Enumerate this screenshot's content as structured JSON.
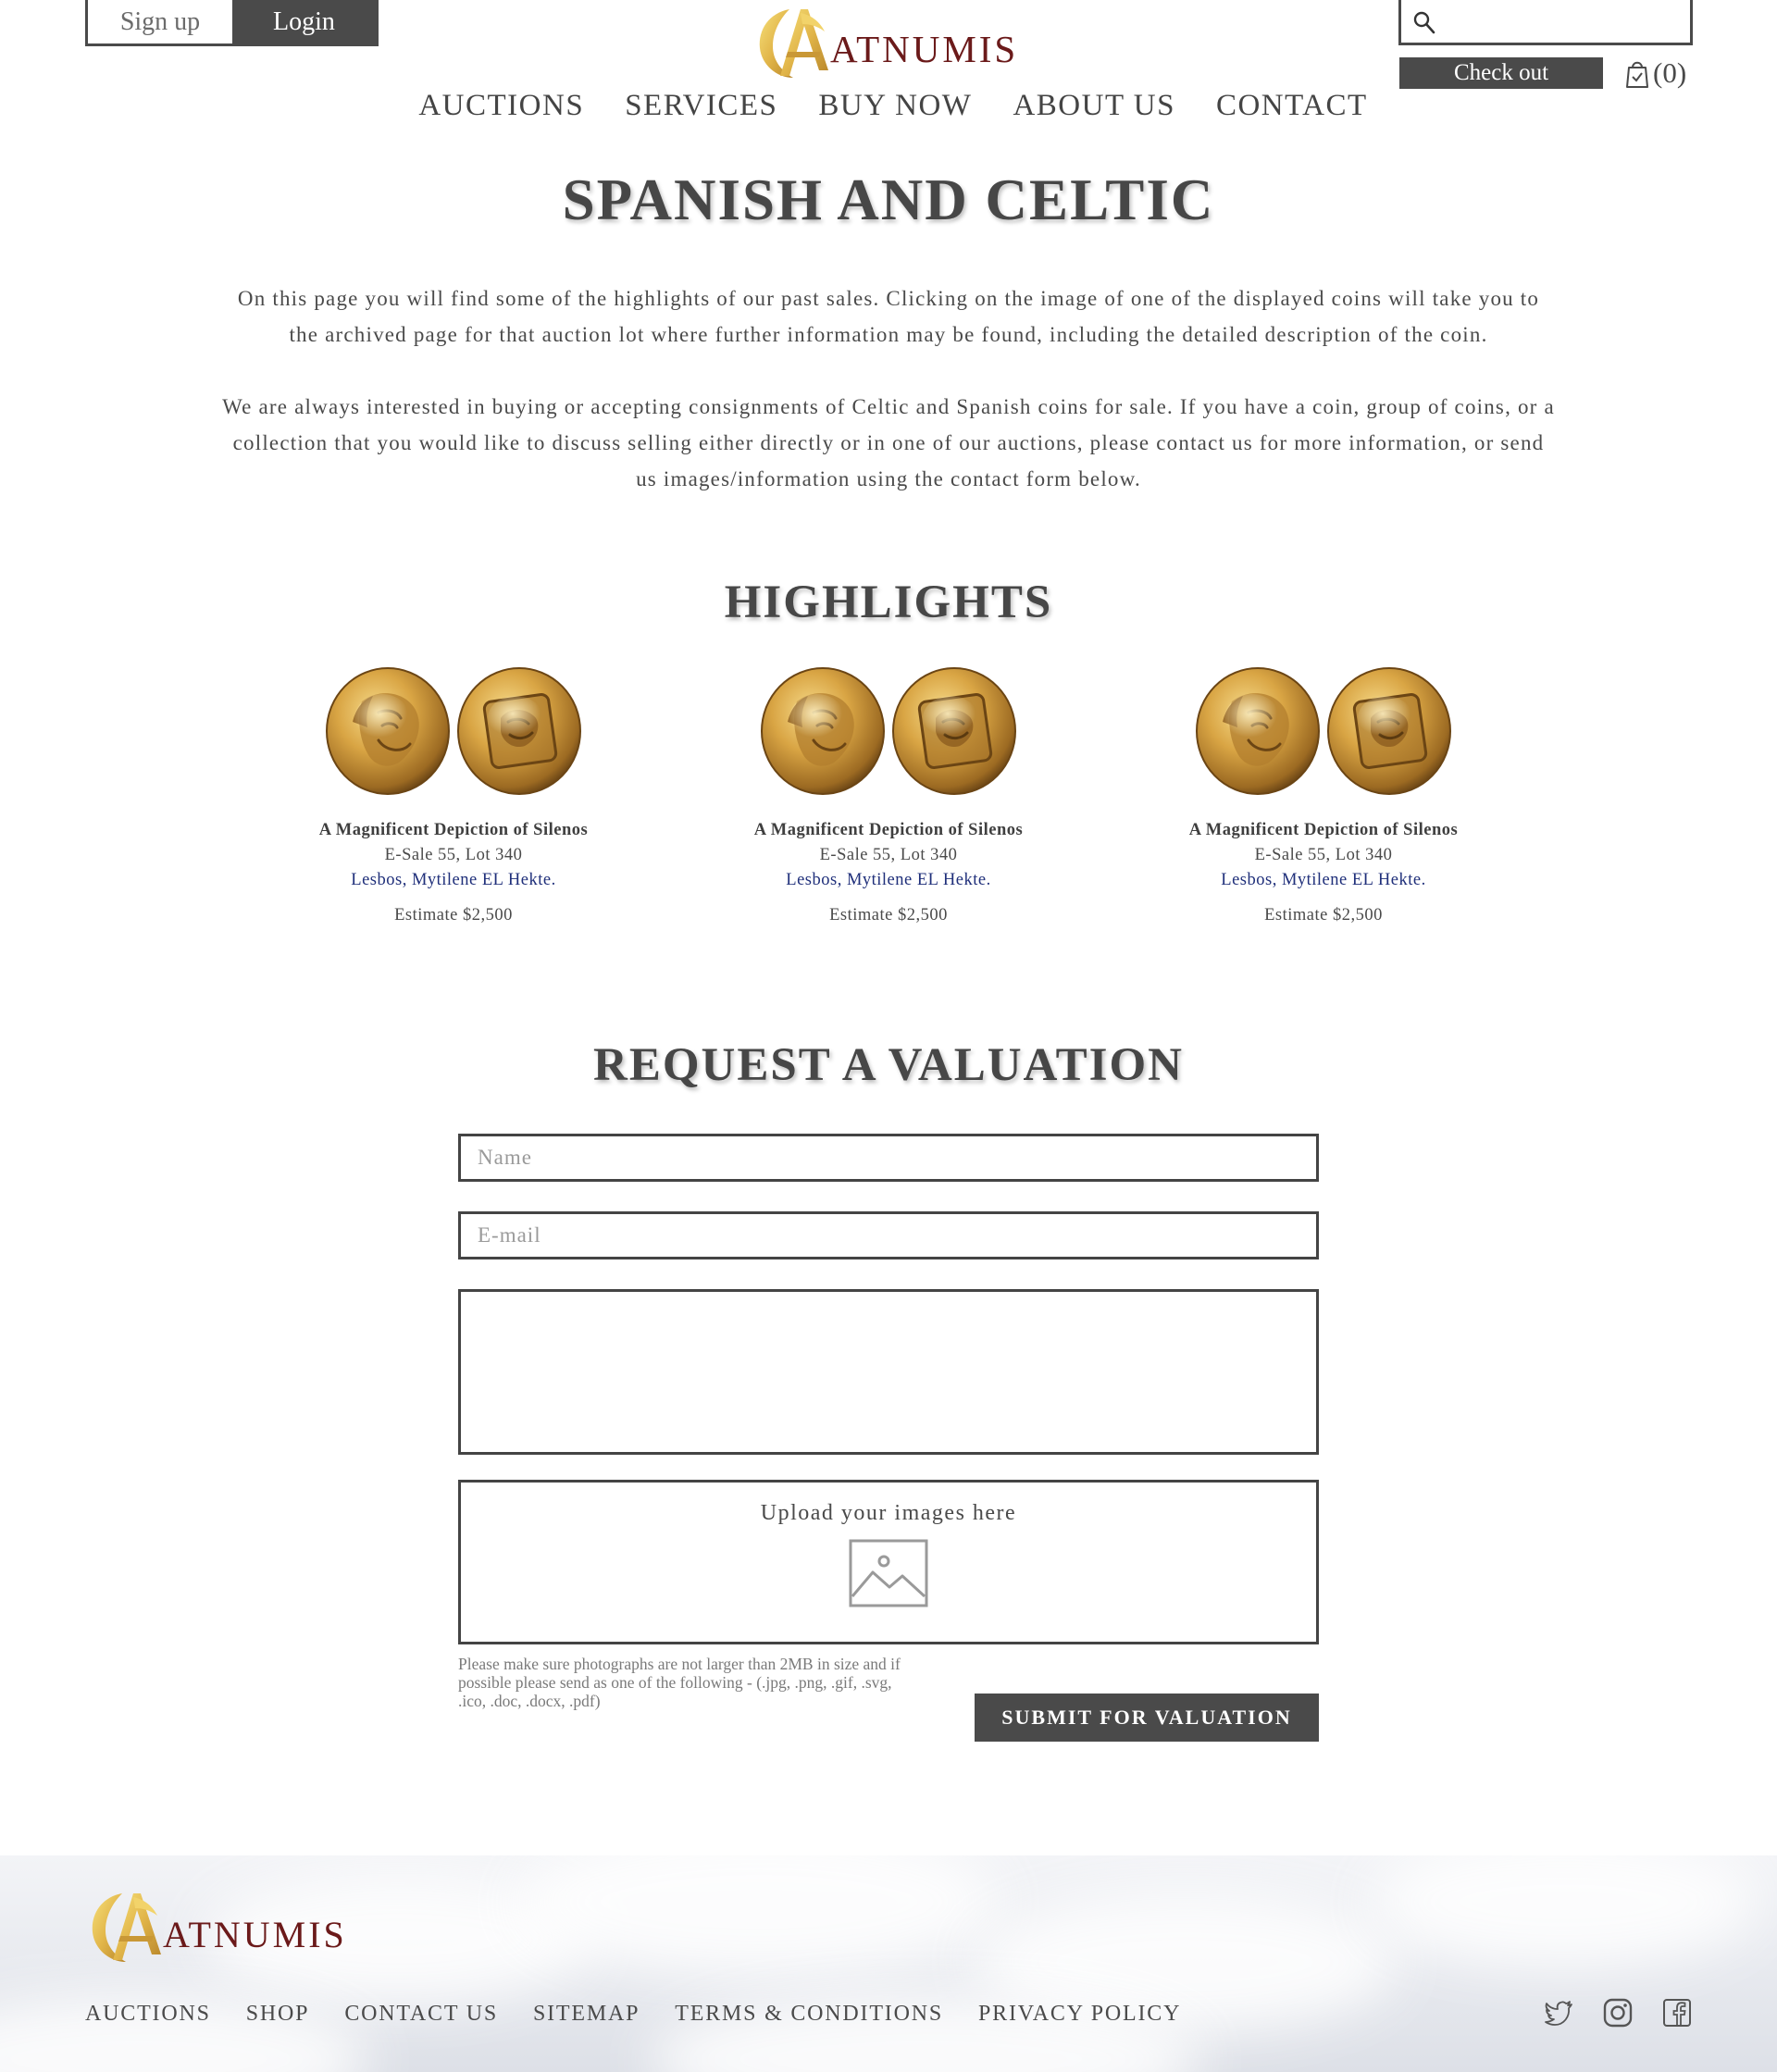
{
  "header": {
    "signup_label": "Sign up",
    "login_label": "Login",
    "brand": "ATNUMIS",
    "search_placeholder": "",
    "checkout_label": "Check out",
    "cart_count": "(0)",
    "nav": [
      "AUCTIONS",
      "SERVICES",
      "BUY NOW",
      "ABOUT US",
      "CONTACT"
    ]
  },
  "page": {
    "title": "SPANISH AND CELTIC",
    "intro_1": "On this page you will find some of the highlights of our past sales. Clicking on the image of one of the displayed coins will take you to the archived page for that auction lot where further information may be found, including the detailed description of the coin.",
    "intro_2": "We are always interested in buying or accepting consignments of Celtic and Spanish coins for sale. If you have a coin, group of coins, or a collection that you would like to discuss selling either directly or in one of our auctions, please contact us for more information, or send us images/information using the contact form below."
  },
  "highlights": {
    "title": "HIGHLIGHTS",
    "items": [
      {
        "title": "A Magnificent Depiction of Silenos",
        "lot": "E-Sale 55, Lot 340",
        "link": "Lesbos, Mytilene EL Hekte.",
        "estimate": "Estimate $2,500"
      },
      {
        "title": "A Magnificent Depiction of Silenos",
        "lot": "E-Sale 55, Lot 340",
        "link": "Lesbos, Mytilene EL Hekte.",
        "estimate": "Estimate $2,500"
      },
      {
        "title": "A Magnificent Depiction of Silenos",
        "lot": "E-Sale 55, Lot 340",
        "link": "Lesbos, Mytilene EL Hekte.",
        "estimate": "Estimate $2,500"
      }
    ]
  },
  "valuation": {
    "title": "REQUEST A VALUATION",
    "name_placeholder": "Name",
    "email_placeholder": "E-mail",
    "message_placeholder": "",
    "upload_label": "Upload your images here",
    "note": "Please make sure photographs are not larger than 2MB in size and if possible please send as one of the following - (.jpg, .png, .gif, .svg, .ico, .doc, .docx, .pdf)",
    "submit_label": "SUBMIT FOR VALUATION"
  },
  "footer": {
    "brand": "ATNUMIS",
    "links": [
      "AUCTIONS",
      "SHOP",
      "CONTACT US",
      "SITEMAP",
      "TERMS & CONDITIONS",
      "PRIVACY POLICY"
    ],
    "social_icons": [
      "twitter-icon",
      "instagram-icon",
      "facebook-icon"
    ]
  },
  "colors": {
    "dark_button": "#4a4a4a",
    "brand_text": "#6b1a1a",
    "logo_gold": "#e2b64a",
    "link_blue": "#1f2f7a"
  }
}
